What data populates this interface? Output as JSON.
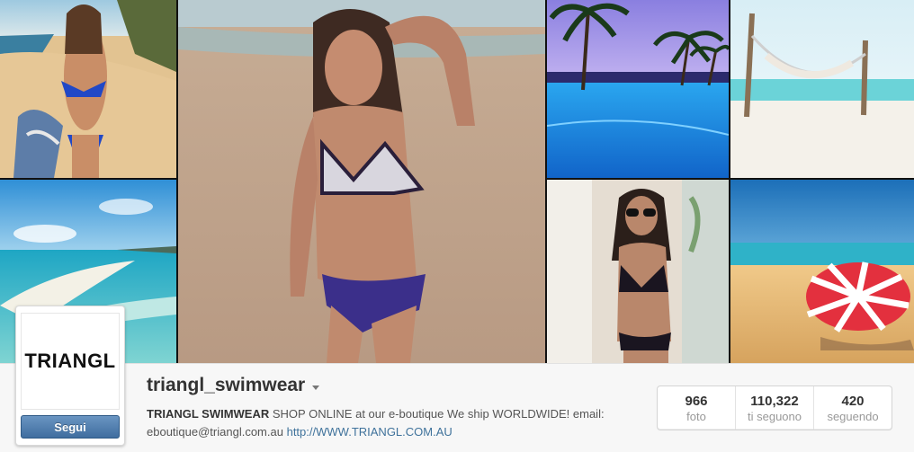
{
  "profile": {
    "avatar_text": "TRIANGL",
    "follow_label": "Segui",
    "username": "triangl_swimwear",
    "bio_name": "TRIANGL SWIMWEAR",
    "bio_text": " SHOP ONLINE at our e-boutique We ship WORLDWIDE! email: ",
    "bio_email": "eboutique@triangl.com.au",
    "bio_link": "http://WWW.TRIANGL.COM.AU"
  },
  "stats": [
    {
      "value": "966",
      "label": "foto"
    },
    {
      "value": "110,322",
      "label": "ti seguono"
    },
    {
      "value": "420",
      "label": "seguendo"
    }
  ],
  "colors": {
    "follow_button": "#4a77a8",
    "link": "#3f729b",
    "profile_bar": "#f7f7f7"
  },
  "collage": [
    {
      "name": "photo-model-beach-blue-bikini",
      "alt": "model in blue bikini on beach"
    },
    {
      "name": "photo-sandbar-lagoon",
      "alt": "turquoise sandbar lagoon"
    },
    {
      "name": "photo-model-beach-center",
      "alt": "model in grey and navy bikini on sand"
    },
    {
      "name": "photo-palm-pool",
      "alt": "resort pool with palm trees"
    },
    {
      "name": "photo-hammock-beach",
      "alt": "hammock on white beach"
    },
    {
      "name": "photo-model-sunglasses",
      "alt": "model in black bikini with sunglasses"
    },
    {
      "name": "photo-umbrella-beach",
      "alt": "red and white beach umbrella"
    }
  ]
}
